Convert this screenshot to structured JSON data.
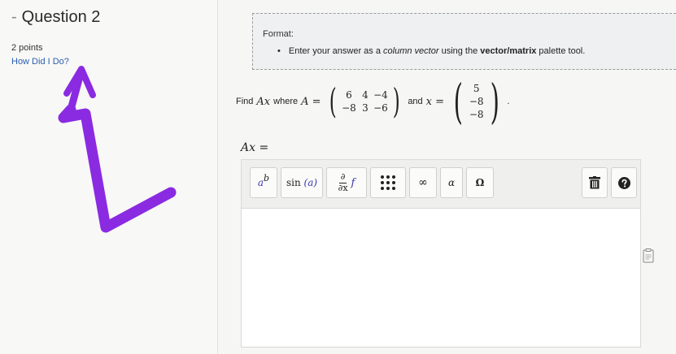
{
  "question": {
    "dash": "-",
    "title": "Question 2",
    "points": "2 points",
    "how_link": "How Did I Do?"
  },
  "format": {
    "label": "Format:",
    "bullet": "•",
    "item_pre": "Enter your answer as a ",
    "item_em": "column vector",
    "item_mid": " using the ",
    "item_bold": "vector/matrix",
    "item_post": " palette tool."
  },
  "problem": {
    "find": "Find",
    "ax": "Ax",
    "where": "where",
    "a_eq": "A =",
    "and": "and",
    "x_eq": "x =",
    "period": ".",
    "matrix_a": [
      [
        "6",
        "4",
        "−4"
      ],
      [
        "−8",
        "3",
        "−6"
      ]
    ],
    "vector_x": [
      "5",
      "−8",
      "−8"
    ]
  },
  "answer_label": "Ax =",
  "toolbar": {
    "superscript_base": "a",
    "superscript_exp": "b",
    "sin_fn": "sin",
    "sin_arg": "(a)",
    "deriv_num": "∂",
    "deriv_den": "∂x",
    "deriv_f": "f",
    "infinity": "∞",
    "alpha": "α",
    "omega": "Ω"
  },
  "colors": {
    "annotation": "#8a2be2",
    "link": "#2a5db0",
    "math_var": "#3a3ab0"
  },
  "icons": {
    "trash": "trash-icon",
    "help": "help-icon",
    "matrix": "matrix-grid-icon",
    "clipboard": "clipboard-icon"
  }
}
